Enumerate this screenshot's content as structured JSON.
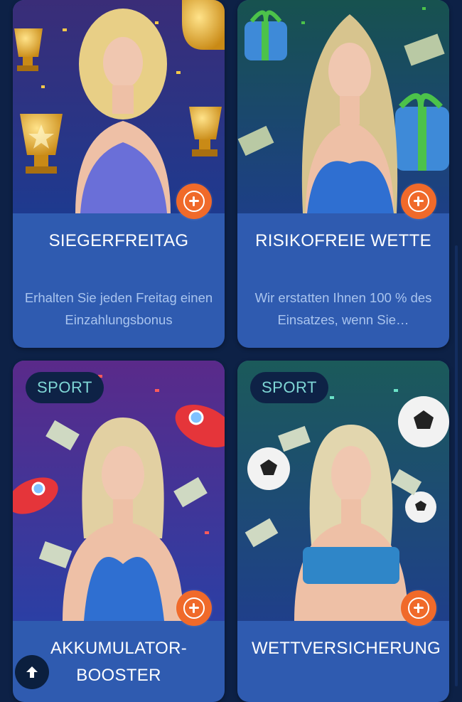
{
  "promotions": [
    {
      "title": "SIEGERFREITAG",
      "description": "Erhalten Sie jeden Freitag einen Einzahlungsbonus",
      "badge": "",
      "image_icon": "trophy-illustration",
      "accent": "#f06a2a"
    },
    {
      "title": "RISIKOFREIE WETTE",
      "description": "Wir erstatten Ihnen 100 % des Einsatzes, wenn Sie…",
      "badge": "",
      "image_icon": "gift-box-illustration",
      "accent": "#f06a2a"
    },
    {
      "title": "AKKUMULATOR-\nBOOSTER",
      "description": "",
      "badge": "SPORT",
      "image_icon": "rocket-illustration",
      "accent": "#f06a2a"
    },
    {
      "title": "WETTVERSICHERUNG",
      "description": "",
      "badge": "SPORT",
      "image_icon": "football-illustration",
      "accent": "#f06a2a"
    }
  ],
  "colors": {
    "page_background": "#0d2146",
    "card_background": "#2f5bb0",
    "plus_button": "#f06a2a",
    "badge_text": "#7fd7d6"
  },
  "back_to_top_icon": "arrow-up-icon"
}
